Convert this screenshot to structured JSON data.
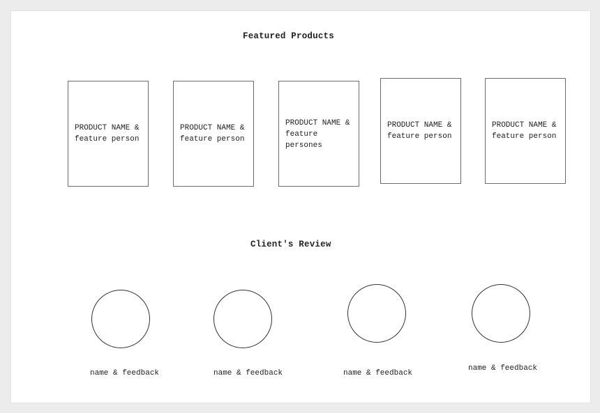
{
  "sections": {
    "featured_title": "Featured Products",
    "review_title": "Client's Review"
  },
  "products": [
    {
      "label": "PRODUCT NAME &\nfeature person"
    },
    {
      "label": "PRODUCT NAME &\nfeature person"
    },
    {
      "label": "PRODUCT NAME &\nfeature\npersones"
    },
    {
      "label": "PRODUCT NAME &\nfeature person"
    },
    {
      "label": "PRODUCT NAME &\nfeature person"
    }
  ],
  "reviews": [
    {
      "label": "name & feedback"
    },
    {
      "label": "name & feedback"
    },
    {
      "label": "name & feedback"
    },
    {
      "label": "name & feedback"
    }
  ]
}
